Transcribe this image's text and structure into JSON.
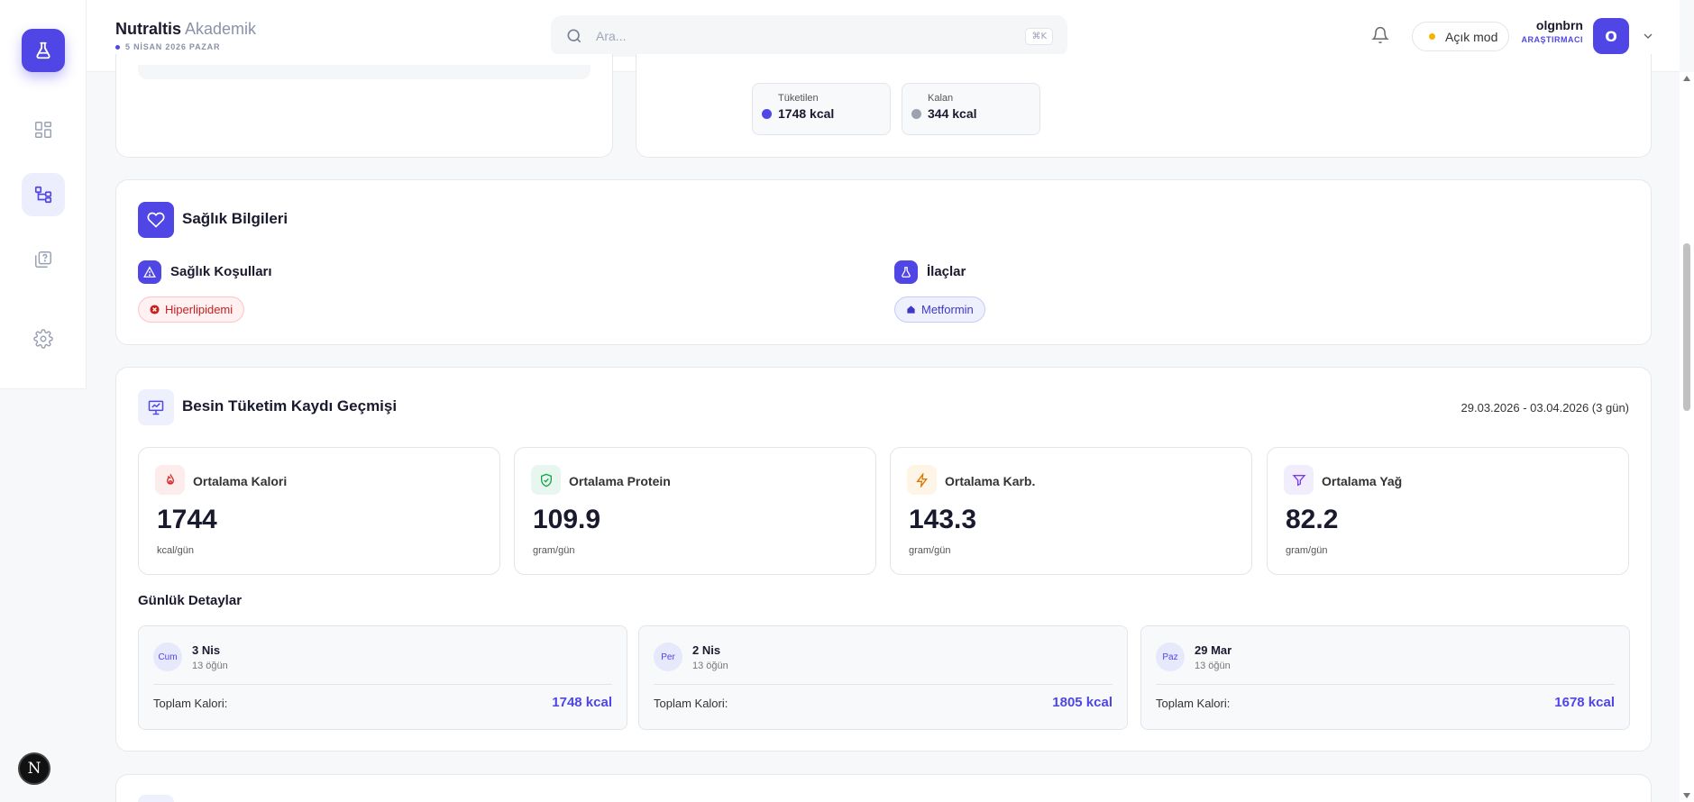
{
  "header": {
    "brand_name": "Nutraltis",
    "brand_suffix": " Akademik",
    "date": "5 NİSAN 2026 PAZAR",
    "search_placeholder": "Ara...",
    "search_shortcut": "⌘K",
    "theme_label": "Açık mod",
    "user_name": "olgnbrn",
    "user_role": "ARAŞTIRMACI",
    "avatar_initial": "O"
  },
  "sidebar": {
    "items": [
      {
        "icon": "dashboard-icon",
        "active": false
      },
      {
        "icon": "hierarchy-icon",
        "active": true
      },
      {
        "icon": "question-book-icon",
        "active": false
      },
      {
        "icon": "gear-icon",
        "active": false
      }
    ],
    "dev_badge": "N"
  },
  "calorie_summary": {
    "consumed_label": "Tüketilen",
    "consumed_value": "1748 kcal",
    "remaining_label": "Kalan",
    "remaining_value": "344 kcal"
  },
  "health": {
    "title": "Sağlık Bilgileri",
    "conditions_title": "Sağlık Koşulları",
    "conditions": [
      "Hiperlipidemi"
    ],
    "medications_title": "İlaçlar",
    "medications": [
      "Metformin"
    ]
  },
  "history": {
    "title": "Besin Tüketim Kaydı Geçmişi",
    "date_range": "29.03.2026 - 03.04.2026 (3 gün)",
    "metrics": [
      {
        "label": "Ortalama Kalori",
        "value": "1744",
        "unit": "kcal/gün",
        "icon": "flame-icon"
      },
      {
        "label": "Ortalama Protein",
        "value": "109.9",
        "unit": "gram/gün",
        "icon": "shield-check-icon"
      },
      {
        "label": "Ortalama Karb.",
        "value": "143.3",
        "unit": "gram/gün",
        "icon": "lightning-icon"
      },
      {
        "label": "Ortalama Yağ",
        "value": "82.2",
        "unit": "gram/gün",
        "icon": "funnel-icon"
      }
    ],
    "daily_title": "Günlük Detaylar",
    "days": [
      {
        "weekday": "Cum",
        "date": "3 Nis",
        "meals": "13 öğün",
        "total_label": "Toplam Kalori:",
        "total": "1748 kcal"
      },
      {
        "weekday": "Per",
        "date": "2 Nis",
        "meals": "13 öğün",
        "total_label": "Toplam Kalori:",
        "total": "1805 kcal"
      },
      {
        "weekday": "Paz",
        "date": "29 Mar",
        "meals": "13 öğün",
        "total_label": "Toplam Kalori:",
        "total": "1678 kcal"
      }
    ]
  },
  "colors": {
    "accent": "#4f46e5",
    "danger": "#c81e1e",
    "remaining_dot": "#9ca3af"
  }
}
